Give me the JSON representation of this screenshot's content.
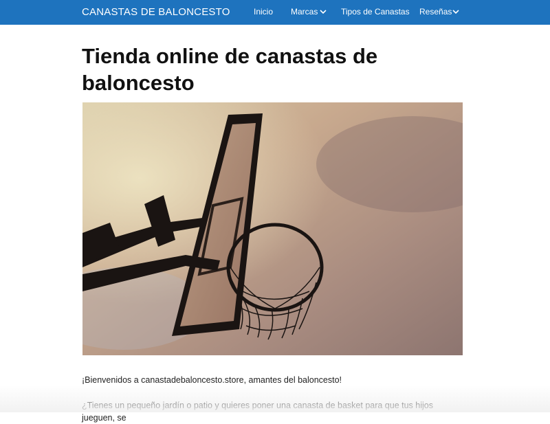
{
  "header": {
    "brand": "CANASTAS DE BALONCESTO",
    "nav": [
      {
        "label": "Inicio",
        "has_dropdown": false
      },
      {
        "label": "Marcas",
        "has_dropdown": true
      },
      {
        "label": "Tipos de Canastas",
        "has_dropdown": false
      },
      {
        "label": "Reseñas",
        "has_dropdown": true
      }
    ],
    "bar_color": "#1e73be"
  },
  "main": {
    "title": "Tienda online de canastas de baloncesto",
    "hero_image_icon": "basketball-hoop-photo",
    "intro": "¡Bienvenidos a canastadebaloncesto.store, amantes del baloncesto!",
    "question": "¿Tienes un pequeño jardín o patio y quieres poner una canasta de basket para que tus hijos jueguen, se"
  }
}
